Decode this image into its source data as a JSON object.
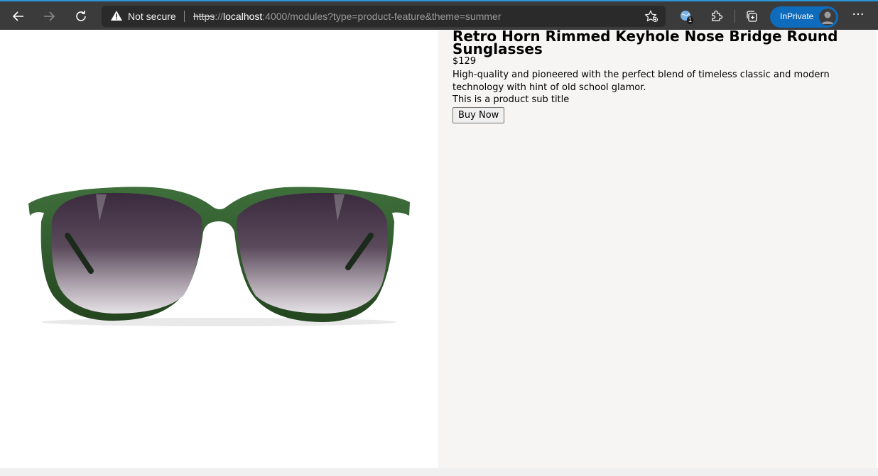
{
  "browser": {
    "security_label": "Not secure",
    "url_scheme": "https",
    "url_sep": "://",
    "url_host": "localhost",
    "url_rest": ":4000/modules?type=product-feature&theme=summer",
    "extension_badge": "1",
    "inprivate_label": "InPrivate",
    "more_glyph": "···"
  },
  "product": {
    "title": "Retro Horn Rimmed Keyhole Nose Bridge Round Sunglasses",
    "price": "$129",
    "description": "High-quality and pioneered with the perfect blend of timeless classic and modern technology with hint of old school glamor.",
    "subtitle": "This is a product sub title",
    "buy_label": "Buy Now"
  },
  "colors": {
    "toolbar": "#3b3b3b",
    "accent": "#0f6cbd",
    "frame_green": "#2f5a2e",
    "pane_bg": "#f6f5f4"
  }
}
